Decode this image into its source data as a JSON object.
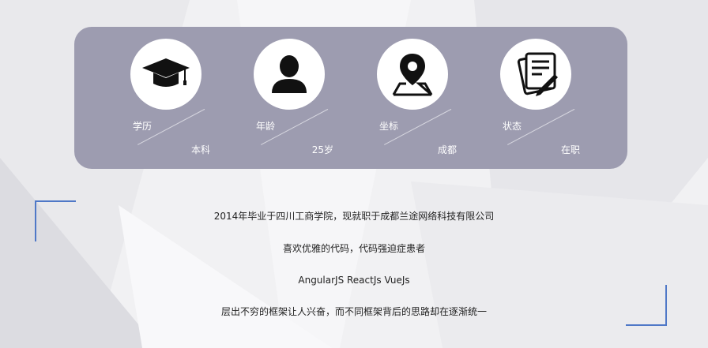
{
  "profile": {
    "items": [
      {
        "key": "学历",
        "value": "本科",
        "icon": "graduation-cap-icon"
      },
      {
        "key": "年龄",
        "value": "25岁",
        "icon": "user-silhouette-icon"
      },
      {
        "key": "坐标",
        "value": "成都",
        "icon": "map-pin-icon"
      },
      {
        "key": "状态",
        "value": "在职",
        "icon": "document-pen-icon"
      }
    ]
  },
  "description": {
    "lines": [
      "2014年毕业于四川工商学院，现就职于成都兰途网络科技有限公司",
      "喜欢优雅的代码，代码强迫症患者",
      "AngularJS ReactJs VueJs",
      "层出不穷的框架让人兴奋，而不同框架背后的思路却在逐渐统一"
    ]
  },
  "colors": {
    "panel": "#9d9cb0",
    "accent_corner": "#4f78c7",
    "background": "#efeff1"
  }
}
